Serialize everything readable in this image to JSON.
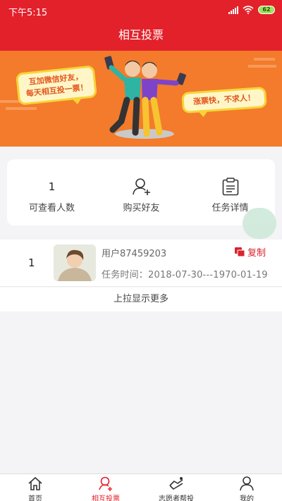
{
  "status_bar": {
    "time": "下午5:15",
    "battery": "62"
  },
  "header": {
    "title": "相互投票"
  },
  "banner": {
    "bubble_left_line1": "互加微信好友，",
    "bubble_left_line2": "每天相互投一票！",
    "bubble_right": "涨票快，不求人！"
  },
  "stats": {
    "viewable": {
      "value": "1",
      "label": "可查看人数"
    },
    "buy_friends": {
      "label": "购买好友",
      "icon": "add-user-icon"
    },
    "task_details": {
      "label": "任务详情",
      "icon": "clipboard-icon"
    }
  },
  "tasks": [
    {
      "index": "1",
      "user": "用户87459203",
      "copy_label": "复制",
      "time": "任务时间：2018-07-30---1970-01-19"
    }
  ],
  "load_more": "上拉显示更多",
  "tabbar": {
    "items": [
      {
        "label": "首页",
        "icon": "home-icon"
      },
      {
        "label": "相互投票",
        "icon": "vote-icon"
      },
      {
        "label": "志愿者帮投",
        "icon": "volunteer-icon"
      },
      {
        "label": "我的",
        "icon": "profile-icon"
      }
    ],
    "active": 1
  },
  "colors": {
    "primary": "#e3212b",
    "banner": "#f37b2b",
    "bubble": "#fff6c8"
  }
}
